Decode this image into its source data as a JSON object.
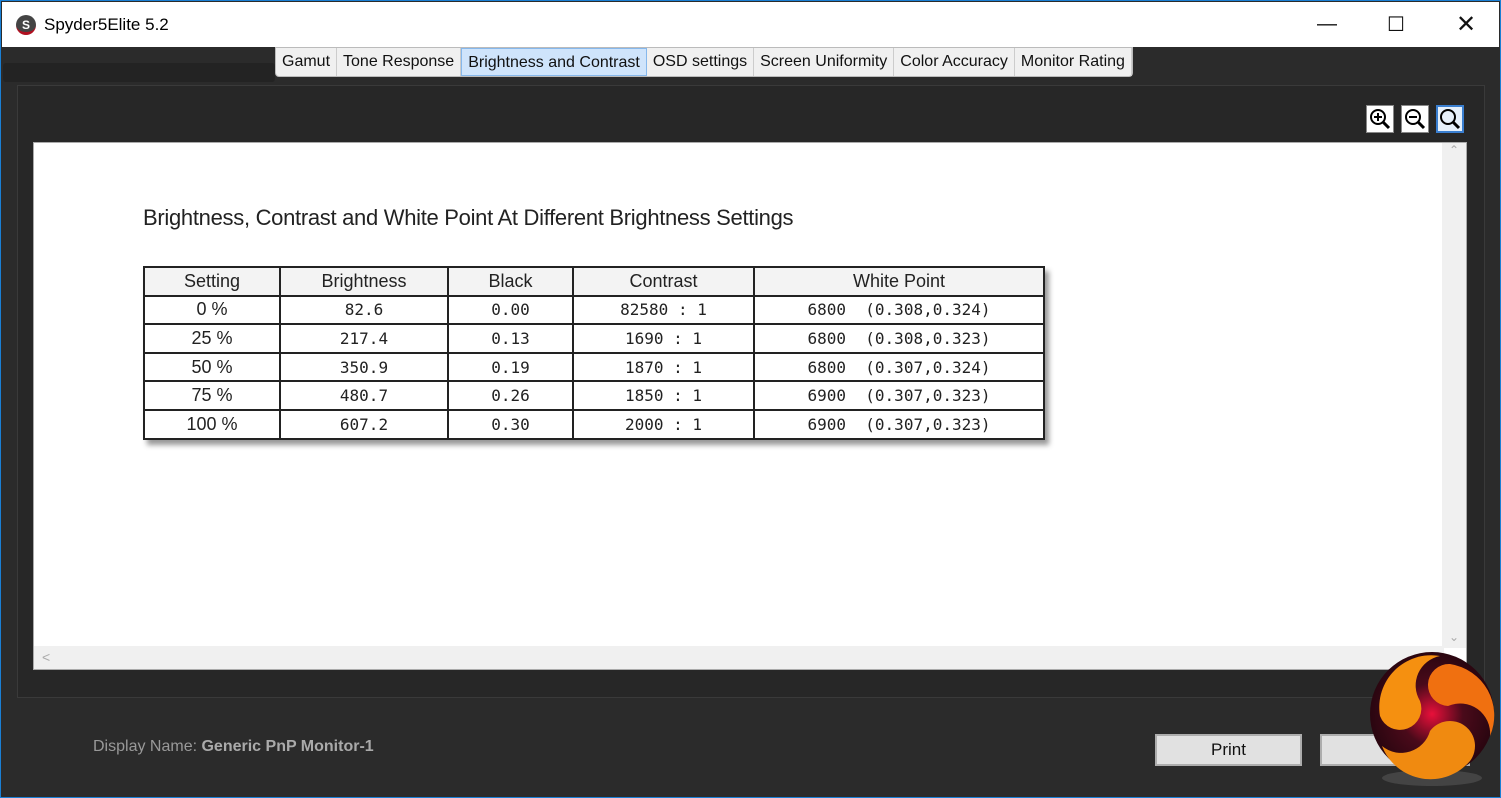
{
  "window": {
    "title": "Spyder5Elite 5.2",
    "controls": [
      "minimize",
      "maximize",
      "close"
    ]
  },
  "tabs": [
    {
      "label": "Gamut"
    },
    {
      "label": "Tone Response"
    },
    {
      "label": "Brightness and Contrast",
      "active": true
    },
    {
      "label": "OSD settings"
    },
    {
      "label": "Screen Uniformity"
    },
    {
      "label": "Color Accuracy"
    },
    {
      "label": "Monitor Rating"
    }
  ],
  "report": {
    "title": "Brightness, Contrast and White Point At Different Brightness Settings",
    "columns": [
      "Setting",
      "Brightness",
      "Black",
      "Contrast",
      "White Point"
    ],
    "rows": [
      [
        "0 %",
        "82.6",
        "0.00",
        "82580 : 1",
        "6800  (0.308,0.324)"
      ],
      [
        "25 %",
        "217.4",
        "0.13",
        "1690 : 1",
        "6800  (0.308,0.323)"
      ],
      [
        "50 %",
        "350.9",
        "0.19",
        "1870 : 1",
        "6800  (0.307,0.324)"
      ],
      [
        "75 %",
        "480.7",
        "0.26",
        "1850 : 1",
        "6900  (0.307,0.323)"
      ],
      [
        "100 %",
        "607.2",
        "0.30",
        "2000 : 1",
        "6900  (0.307,0.323)"
      ]
    ]
  },
  "footer": {
    "display_label": "Display Name:",
    "display_value": "Generic PnP Monitor-1",
    "print_label": "Print"
  }
}
